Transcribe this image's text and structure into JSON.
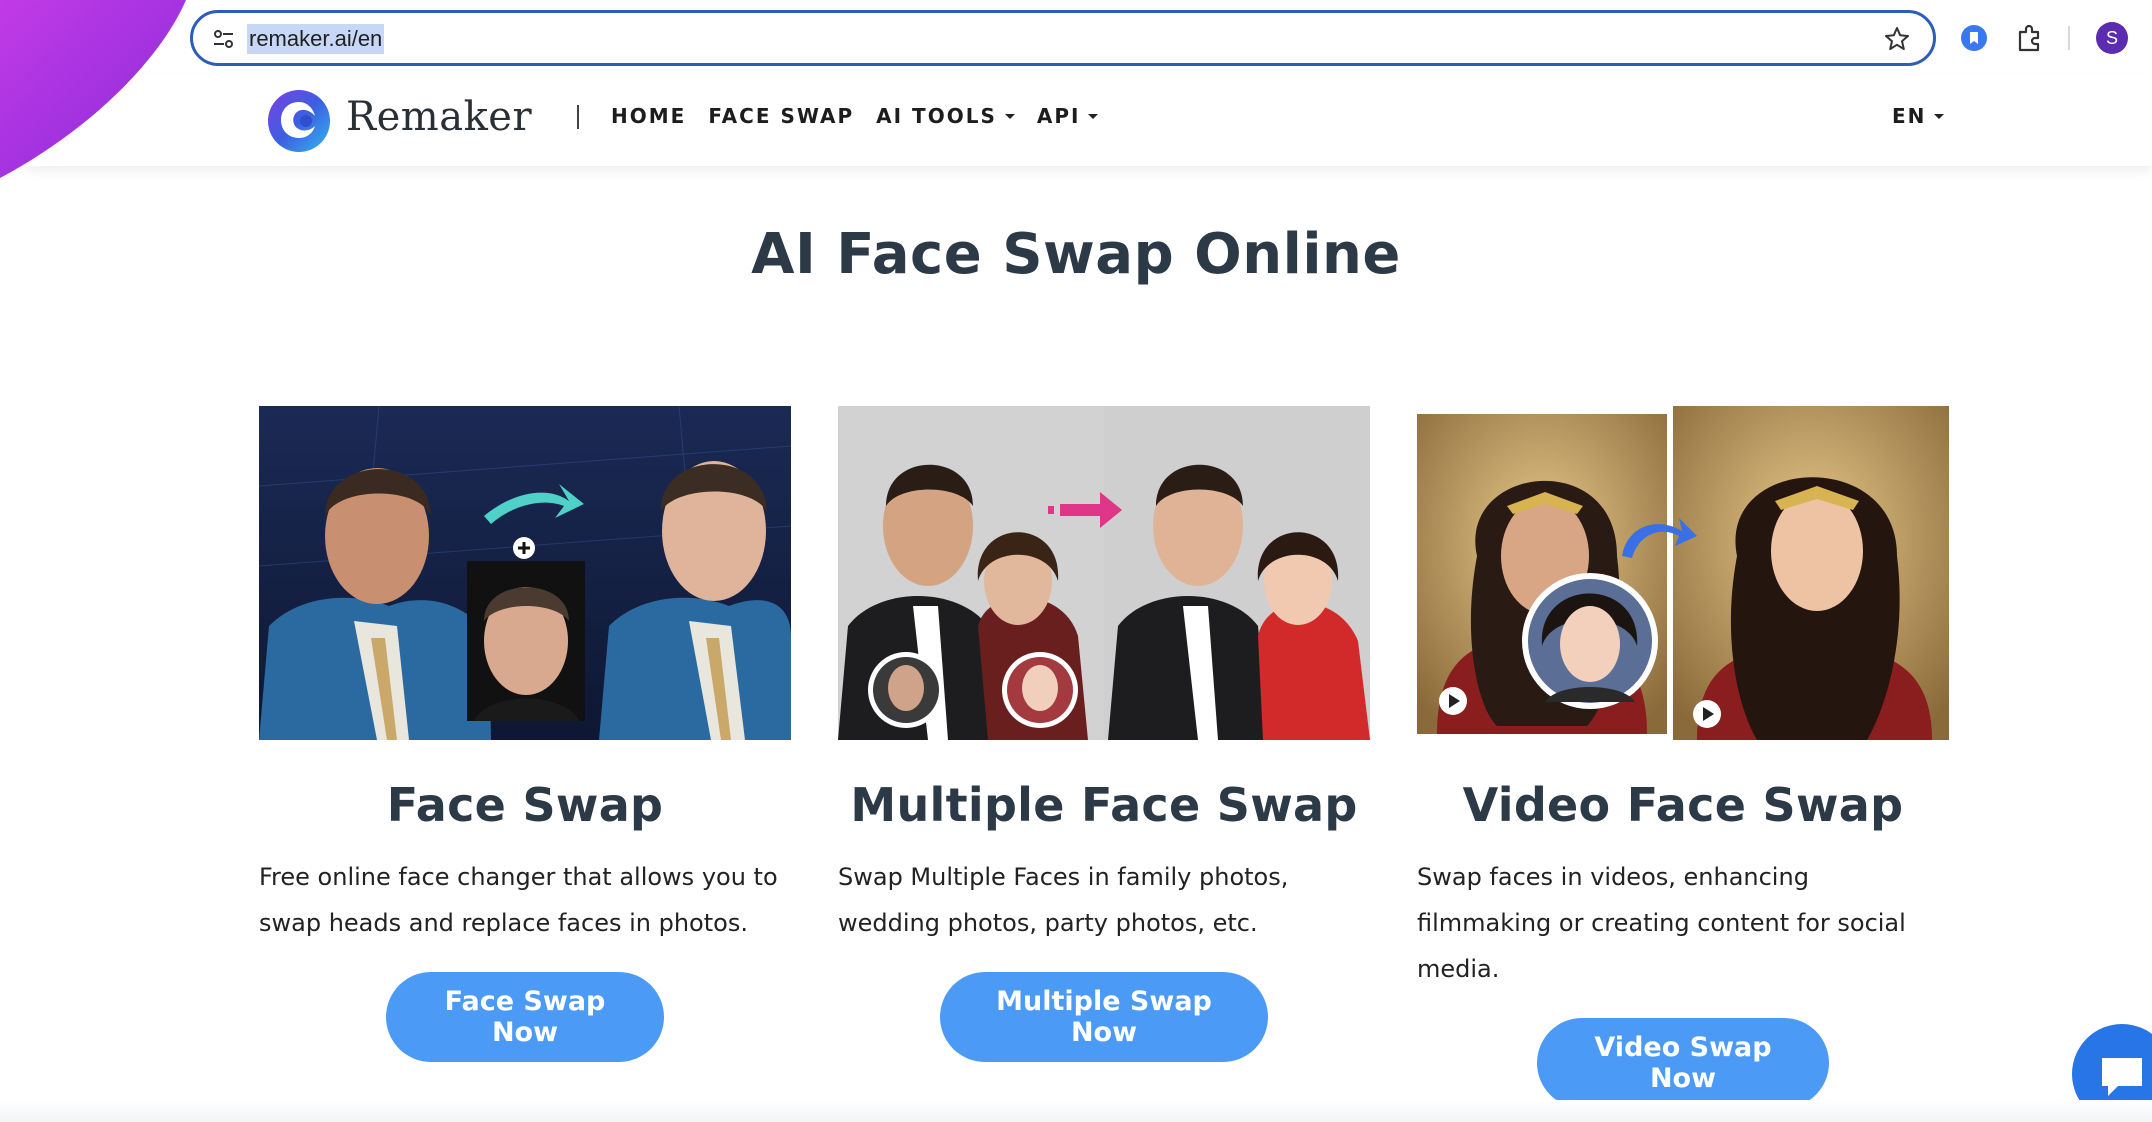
{
  "browser": {
    "url": "remaker.ai/en",
    "profile_initial": "S",
    "icons": [
      "reload-icon",
      "site-settings-icon",
      "bookmark-star-icon",
      "extension-bookmark-icon",
      "extensions-puzzle-icon"
    ]
  },
  "header": {
    "brand": "Remaker",
    "nav": [
      {
        "label": "HOME"
      },
      {
        "label": "FACE SWAP"
      },
      {
        "label": "AI TOOLS"
      },
      {
        "label": "API"
      }
    ],
    "language": "EN"
  },
  "main": {
    "title": "AI Face Swap Online",
    "cards": [
      {
        "title": "Face Swap",
        "description": "Free online face changer that allows you to swap heads and replace faces in photos.",
        "button": "Face Swap Now"
      },
      {
        "title": "Multiple Face Swap",
        "description": "Swap Multiple Faces in family photos, wedding photos, party photos, etc.",
        "button": "Multiple Swap Now"
      },
      {
        "title": "Video Face Swap",
        "description": "Swap faces in videos, enhancing filmmaking or creating content for social media.",
        "button": "Video Swap Now"
      }
    ]
  },
  "colors": {
    "accent_button": "#4b9bf6",
    "omnibox_border": "#2c5db8",
    "title_text": "#2c3a47",
    "chat_button": "#2775e6"
  }
}
